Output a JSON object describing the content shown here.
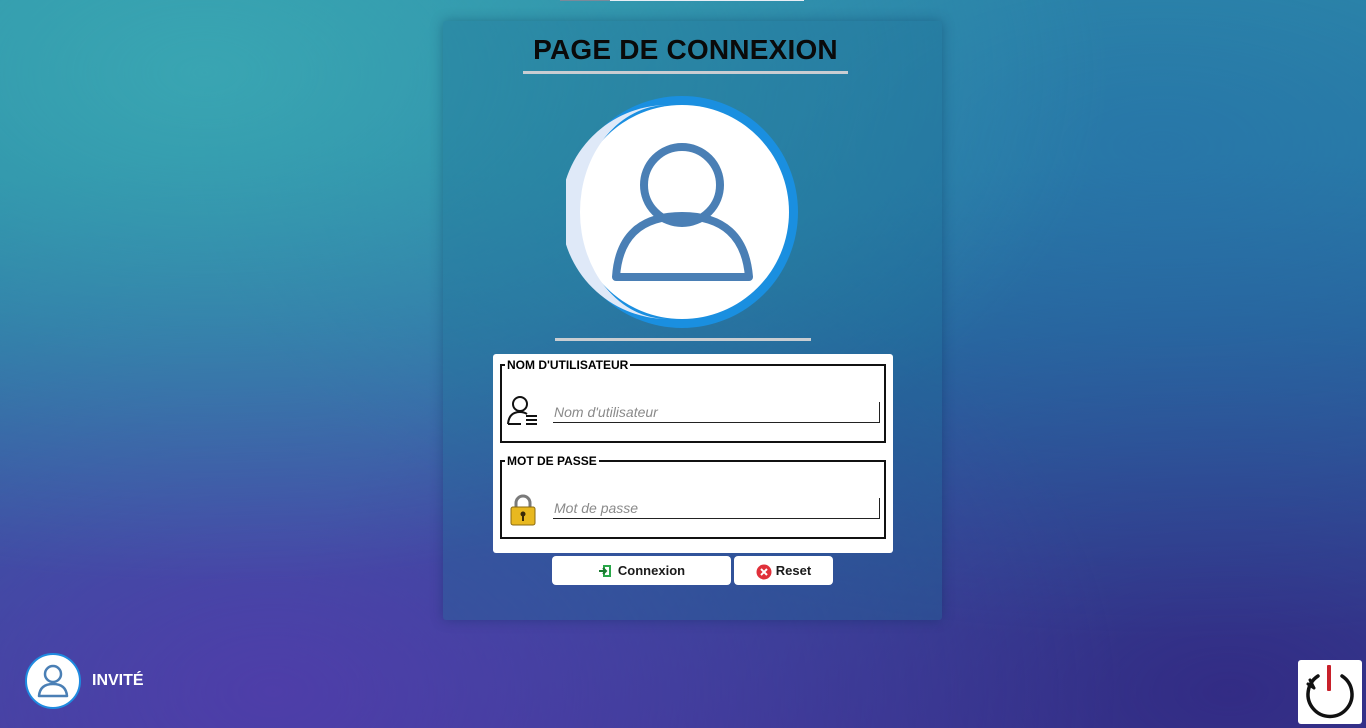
{
  "page": {
    "title": "PAGE DE CONNEXION"
  },
  "form": {
    "username": {
      "legend": "NOM D'UTILISATEUR",
      "placeholder": "Nom d'utilisateur",
      "value": ""
    },
    "password": {
      "legend": "MOT DE PASSE",
      "placeholder": "Mot de passe",
      "value": ""
    }
  },
  "buttons": {
    "connexion_label": "Connexion",
    "reset_label": "Reset"
  },
  "user_status": {
    "label": "INVITÉ"
  },
  "icons": {
    "avatar": "user-avatar-icon",
    "username_field": "user-list-icon",
    "password_field": "padlock-icon",
    "connexion": "login-arrow-icon",
    "reset": "close-circle-icon",
    "guest": "user-avatar-icon",
    "power": "power-icon"
  },
  "colors": {
    "accent_blue": "#1a8fe0",
    "avatar_stroke": "#4a7fb5",
    "connexion_icon": "#2aa84a",
    "reset_icon": "#e0303a",
    "padlock": "#e8b820",
    "power_red": "#c8202a"
  }
}
